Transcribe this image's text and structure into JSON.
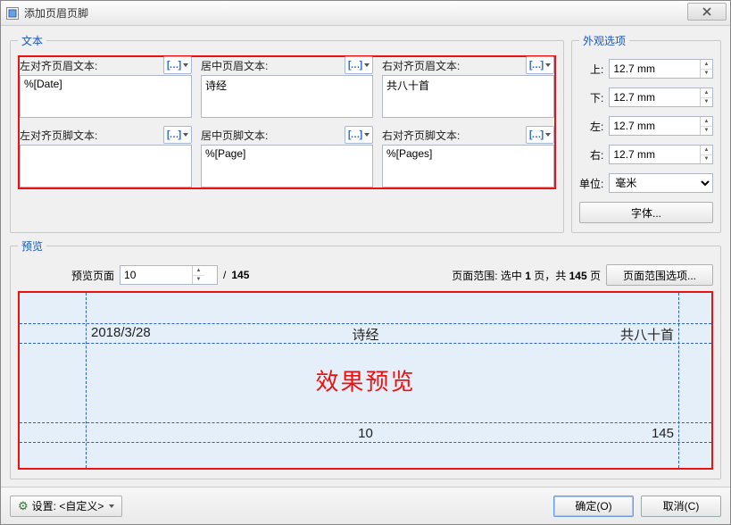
{
  "window": {
    "title": "添加页眉页脚"
  },
  "groups": {
    "text": "文本",
    "appearance": "外观选项",
    "preview": "预览"
  },
  "fields": {
    "hl": {
      "label": "左对齐页眉文本:",
      "value": "%[Date]"
    },
    "hc": {
      "label": "居中页眉文本:",
      "value": "诗经"
    },
    "hr": {
      "label": "右对齐页眉文本:",
      "value": "共八十首"
    },
    "fl": {
      "label": "左对齐页脚文本:",
      "value": ""
    },
    "fc": {
      "label": "居中页脚文本:",
      "value": "%[Page]"
    },
    "fr": {
      "label": "右对齐页脚文本:",
      "value": "%[Pages]"
    }
  },
  "margins": {
    "top": {
      "label": "上:",
      "value": "12.7 mm"
    },
    "bottom": {
      "label": "下:",
      "value": "12.7 mm"
    },
    "left": {
      "label": "左:",
      "value": "12.7 mm"
    },
    "right": {
      "label": "右:",
      "value": "12.7 mm"
    }
  },
  "unit": {
    "label": "单位:",
    "value": "毫米"
  },
  "font_btn": "字体...",
  "preview": {
    "page_label": "预览页面",
    "page_value": "10",
    "page_sep": "/",
    "page_total": "145",
    "range_prefix": "页面范围: 选中 ",
    "range_sel": "1",
    "range_mid": " 页，共 ",
    "range_total": "145",
    "range_suffix": " 页",
    "range_btn": "页面范围选项...",
    "hl": "2018/3/28",
    "hc": "诗经",
    "hr": "共八十首",
    "fc": "10",
    "fr": "145",
    "overlay": "效果预览"
  },
  "footer": {
    "settings": "设置: <自定义>",
    "ok": "确定(O)",
    "cancel": "取消(C)"
  }
}
